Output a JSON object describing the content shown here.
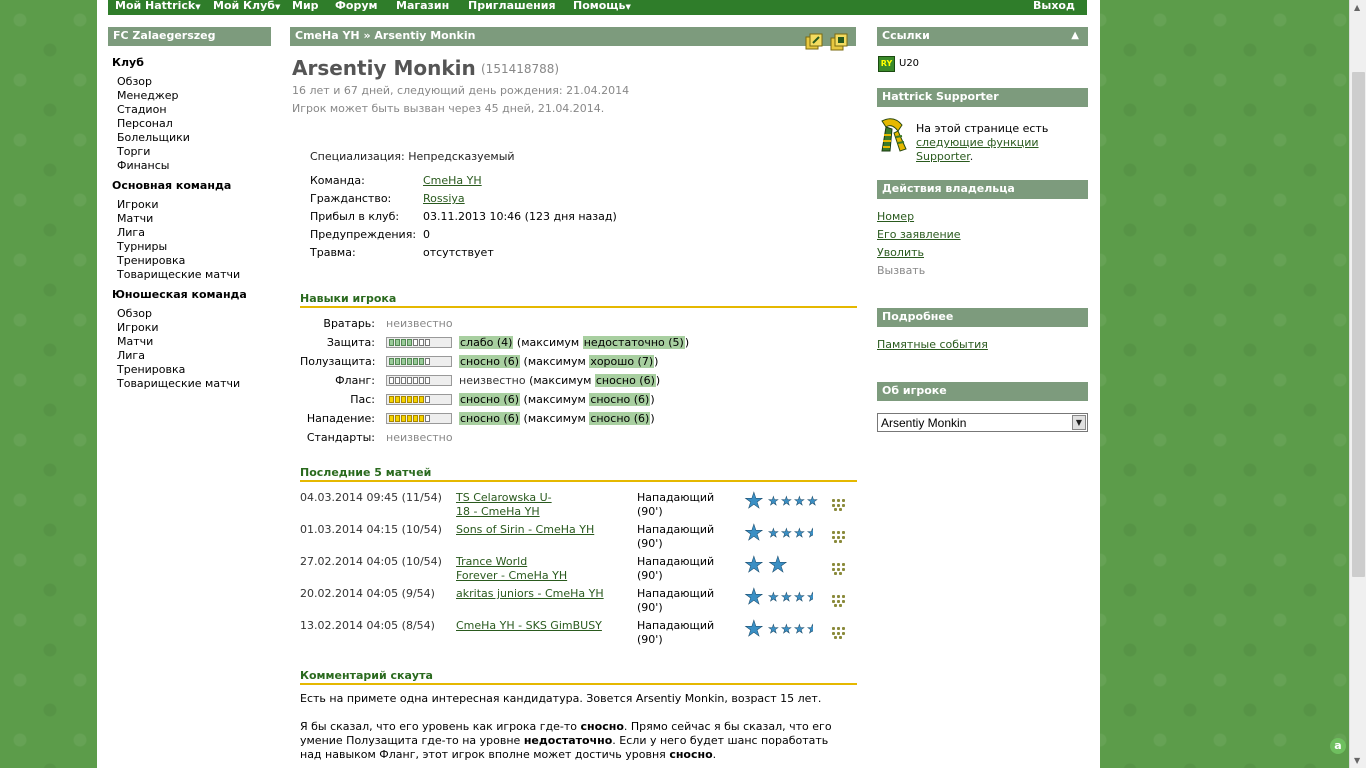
{
  "topnav": {
    "items": [
      "Мой Hattrick",
      "Мой Клуб",
      "Мир",
      "Форум",
      "Магазин",
      "Приглашения",
      "Помощь"
    ],
    "logout": "Выход"
  },
  "sidebar": {
    "club_name": "FC Zalaegerszeg",
    "groups": [
      {
        "title": "Клуб",
        "links": [
          "Обзор",
          "Менеджер",
          "Стадион",
          "Персонал",
          "Болельщики",
          "Торги",
          "Финансы"
        ]
      },
      {
        "title": "Основная команда",
        "links": [
          "Игроки",
          "Матчи",
          "Лига",
          "Турниры",
          "Тренировка",
          "Товарищеские матчи"
        ]
      },
      {
        "title": "Юношеская команда",
        "links": [
          "Обзор",
          "Игроки",
          "Матчи",
          "Лига",
          "Тренировка",
          "Товарищеские матчи"
        ]
      }
    ]
  },
  "breadcrumb": {
    "team": "CmeHa YH",
    "sep": "»",
    "player": "Arsentiy Monkin"
  },
  "player": {
    "name": "Arsentiy Monkin",
    "id": "(151418788)",
    "age_line": "16 лет и 67 дней, следующий день рождения: 21.04.2014",
    "call_line": "Игрок может быть вызван через 45 дней, 21.04.2014.",
    "specialty_label": "Специализация:",
    "specialty_value": "Непредсказуемый",
    "info": [
      {
        "label": "Команда:",
        "value": "CmeHa YH",
        "link": true
      },
      {
        "label": "Гражданство:",
        "value": "Rossiya",
        "link": true
      },
      {
        "label": "Прибыл в клуб:",
        "value": "03.11.2013 10:46 (123 дня назад)",
        "link": false
      },
      {
        "label": "Предупреждения:",
        "value": "0",
        "link": false
      },
      {
        "label": "Травма:",
        "value": "отсутствует",
        "link": false
      }
    ]
  },
  "skills": {
    "title": "Навыки игрока",
    "rows": [
      {
        "label": "Вратарь:",
        "bar": false,
        "current": "неизвестно"
      },
      {
        "label": "Защита:",
        "bar": true,
        "color": "g",
        "level": 4,
        "current": "слабо (4)",
        "max_prefix": "(максимум ",
        "max": "недостаточно (5)",
        "max_suffix": ")"
      },
      {
        "label": "Полузащита:",
        "bar": true,
        "color": "g",
        "level": 6,
        "current": "сносно (6)",
        "max_prefix": "(максимум ",
        "max": "хорошо (7)",
        "max_suffix": ")"
      },
      {
        "label": "Фланг:",
        "bar": true,
        "color": "n",
        "level": 0,
        "current": "неизвестно",
        "plain": true,
        "max_prefix": "(максимум ",
        "max": "сносно (6)",
        "max_suffix": ")"
      },
      {
        "label": "Пас:",
        "bar": true,
        "color": "y",
        "level": 6,
        "current": "сносно (6)",
        "max_prefix": "(максимум ",
        "max": "сносно (6)",
        "max_suffix": ")"
      },
      {
        "label": "Нападение:",
        "bar": true,
        "color": "y",
        "level": 6,
        "current": "сносно (6)",
        "max_prefix": "(максимум ",
        "max": "сносно (6)",
        "max_suffix": ")"
      },
      {
        "label": "Стандарты:",
        "bar": false,
        "current": "неизвестно"
      }
    ]
  },
  "matches": {
    "title": "Последние 5 матчей",
    "rows": [
      {
        "date": "04.03.2014 09:45 (11/54)",
        "match_l1": "TS Celarowska U-",
        "match_l2": "18 - CmeHa YH",
        "pos": "Нападающий",
        "min": "(90')",
        "big_stars": 1,
        "small_stars": 4
      },
      {
        "date": "01.03.2014 04:15 (10/54)",
        "match_l1": "Sons of Sirin - CmeHa YH",
        "match_l2": "",
        "pos": "Нападающий",
        "min": "(90')",
        "big_stars": 1,
        "small_stars": 3.5
      },
      {
        "date": "27.02.2014 04:05 (10/54)",
        "match_l1": "Trance World",
        "match_l2": "Forever - CmeHa YH",
        "pos": "Нападающий",
        "min": "(90')",
        "big_stars": 2,
        "small_stars": 0
      },
      {
        "date": "20.02.2014 04:05 (9/54)",
        "match_l1": "akritas juniors - CmeHa YH",
        "match_l2": "",
        "pos": "Нападающий",
        "min": "(90')",
        "big_stars": 1,
        "small_stars": 3.5
      },
      {
        "date": "13.02.2014 04:05 (8/54)",
        "match_l1": "CmeHa YH - SKS GimBUSY",
        "match_l2": "",
        "pos": "Нападающий",
        "min": "(90')",
        "big_stars": 1,
        "small_stars": 3.5
      }
    ]
  },
  "scout": {
    "title": "Комментарий скаута",
    "p1": "Есть на примете одна интересная кандидатура. Зовется Arsentiy Monkin, возраст 15 лет.",
    "p2a": "Я бы сказал, что его уровень как игрока где-то ",
    "p2b": "сносно",
    "p2c": ". Прямо сейчас я бы сказал, что его",
    "p3a": "умение Полузащита где-то на уровне ",
    "p3b": "недостаточно",
    "p3c": ". Если у него будет шанс поработать",
    "p4a": "над навыком Фланг, этот игрок вполне может достичь уровня ",
    "p4b": "сносно",
    "p4c": "."
  },
  "right": {
    "links_title": "Ссылки",
    "u20_label": "U20",
    "supporter_title": "Hattrick Supporter",
    "supporter_text1": "На этой странице есть",
    "supporter_link1": "следующие функции",
    "supporter_link2": "Supporter",
    "supporter_dot": ".",
    "owner_title": "Действия владельца",
    "owner_links": [
      "Номер",
      "Его заявление",
      "Уволить"
    ],
    "owner_disabled": "Вызвать",
    "more_title": "Подробнее",
    "more_link": "Памятные события",
    "about_title": "Об игроке",
    "about_select": "Arsentiy Monkin"
  }
}
